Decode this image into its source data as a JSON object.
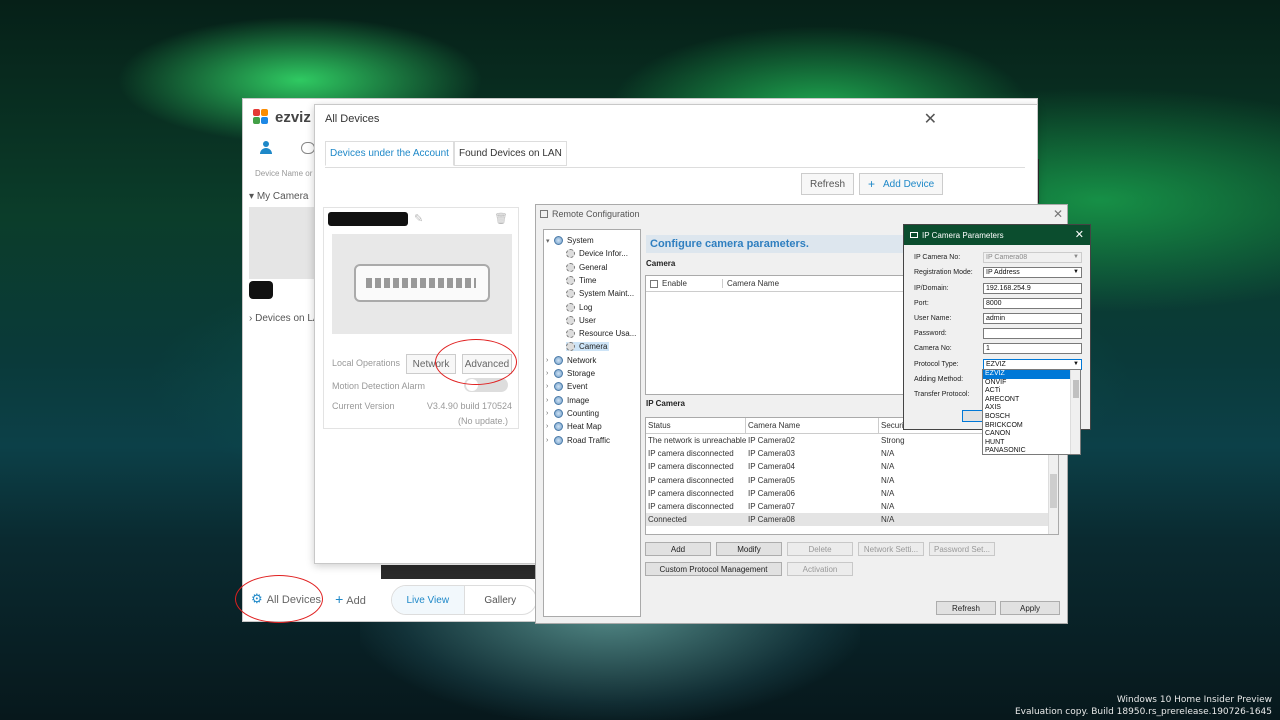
{
  "watermark": {
    "line1": "Windows 10 Home Insider Preview",
    "line2": "Evaluation copy. Build 18950.rs_prerelease.190726-1645"
  },
  "ezviz": {
    "logo": "ezviz",
    "search_placeholder": "Device Name or",
    "my_camera": "My Camera",
    "devices_on_lan": "Devices on LA",
    "all_devices": "All Devices",
    "add": "Add",
    "live_view": "Live View",
    "gallery": "Gallery"
  },
  "all_devices_dialog": {
    "title": "All Devices",
    "tabs": [
      "Devices under the Account",
      "Found Devices on LAN"
    ],
    "refresh": "Refresh",
    "add_device": "Add Device",
    "card": {
      "local_operations": "Local Operations",
      "network": "Network",
      "advanced": "Advanced",
      "motion_alarm": "Motion Detection Alarm",
      "current_version": "Current Version",
      "version": "V3.4.90 build 170524",
      "update": "(No update.)"
    }
  },
  "remote_config": {
    "title": "Remote Configuration",
    "tree": [
      {
        "label": "System",
        "level": 0,
        "expanded": true,
        "icon": "globe-icon"
      },
      {
        "label": "Device Infor...",
        "level": 1,
        "icon": "gear-icon"
      },
      {
        "label": "General",
        "level": 1,
        "icon": "gear-icon"
      },
      {
        "label": "Time",
        "level": 1,
        "icon": "gear-icon"
      },
      {
        "label": "System Maint...",
        "level": 1,
        "icon": "gear-icon"
      },
      {
        "label": "Log",
        "level": 1,
        "icon": "gear-icon"
      },
      {
        "label": "User",
        "level": 1,
        "icon": "gear-icon"
      },
      {
        "label": "Resource Usa...",
        "level": 1,
        "icon": "gear-icon"
      },
      {
        "label": "Camera",
        "level": 1,
        "icon": "gear-icon",
        "selected": true
      },
      {
        "label": "Network",
        "level": 0,
        "icon": "globe-icon"
      },
      {
        "label": "Storage",
        "level": 0,
        "icon": "globe-icon"
      },
      {
        "label": "Event",
        "level": 0,
        "icon": "globe-icon"
      },
      {
        "label": "Image",
        "level": 0,
        "icon": "globe-icon"
      },
      {
        "label": "Counting",
        "level": 0,
        "icon": "globe-icon"
      },
      {
        "label": "Heat Map",
        "level": 0,
        "icon": "globe-icon"
      },
      {
        "label": "Road Traffic",
        "level": 0,
        "icon": "globe-icon"
      }
    ],
    "heading": "Configure camera parameters.",
    "camera_section": "Camera",
    "camera_cols": [
      "Enable",
      "Camera Name"
    ],
    "ip_section": "IP Camera",
    "ip_cols": [
      "Status",
      "Camera Name",
      "Securit"
    ],
    "ip_rows": [
      [
        "The network is unreachable",
        "IP Camera02",
        "Strong"
      ],
      [
        "IP camera disconnected",
        "IP Camera03",
        "N/A"
      ],
      [
        "IP camera disconnected",
        "IP Camera04",
        "N/A"
      ],
      [
        "IP camera disconnected",
        "IP Camera05",
        "N/A"
      ],
      [
        "IP camera disconnected",
        "IP Camera06",
        "N/A"
      ],
      [
        "IP camera disconnected",
        "IP Camera07",
        "N/A"
      ],
      [
        "Connected",
        "IP Camera08",
        "N/A"
      ]
    ],
    "buttons": {
      "add": "Add",
      "modify": "Modify",
      "delete": "Delete",
      "network_settings": "Network Setti...",
      "password_settings": "Password Set...",
      "custom_protocol": "Custom Protocol Management",
      "activation": "Activation",
      "refresh": "Refresh",
      "apply": "Apply"
    }
  },
  "ip_camera_params": {
    "title": "IP Camera Parameters",
    "fields": {
      "ip_camera_no": {
        "label": "IP Camera No:",
        "value": "IP Camera08"
      },
      "registration_mode": {
        "label": "Registration Mode:",
        "value": "IP Address"
      },
      "ip_domain": {
        "label": "IP/Domain:",
        "value": "192.168.254.9"
      },
      "port": {
        "label": "Port:",
        "value": "8000"
      },
      "user_name": {
        "label": "User Name:",
        "value": "admin"
      },
      "password": {
        "label": "Password:",
        "value": ""
      },
      "camera_no": {
        "label": "Camera No:",
        "value": "1"
      },
      "protocol_type": {
        "label": "Protocol Type:",
        "value": "EZVIZ"
      },
      "adding_method": {
        "label": "Adding Method:"
      },
      "transfer_protocol": {
        "label": "Transfer Protocol:"
      }
    },
    "protocol_options": [
      "EZVIZ",
      "ONVIF",
      "ACTi",
      "ARECONT",
      "AXIS",
      "BOSCH",
      "BRICKCOM",
      "CANON",
      "HUNT",
      "PANASONIC"
    ]
  },
  "colors": {
    "accent": "#1e88c8",
    "annotation": "#e02020",
    "selection": "#0078d7"
  }
}
